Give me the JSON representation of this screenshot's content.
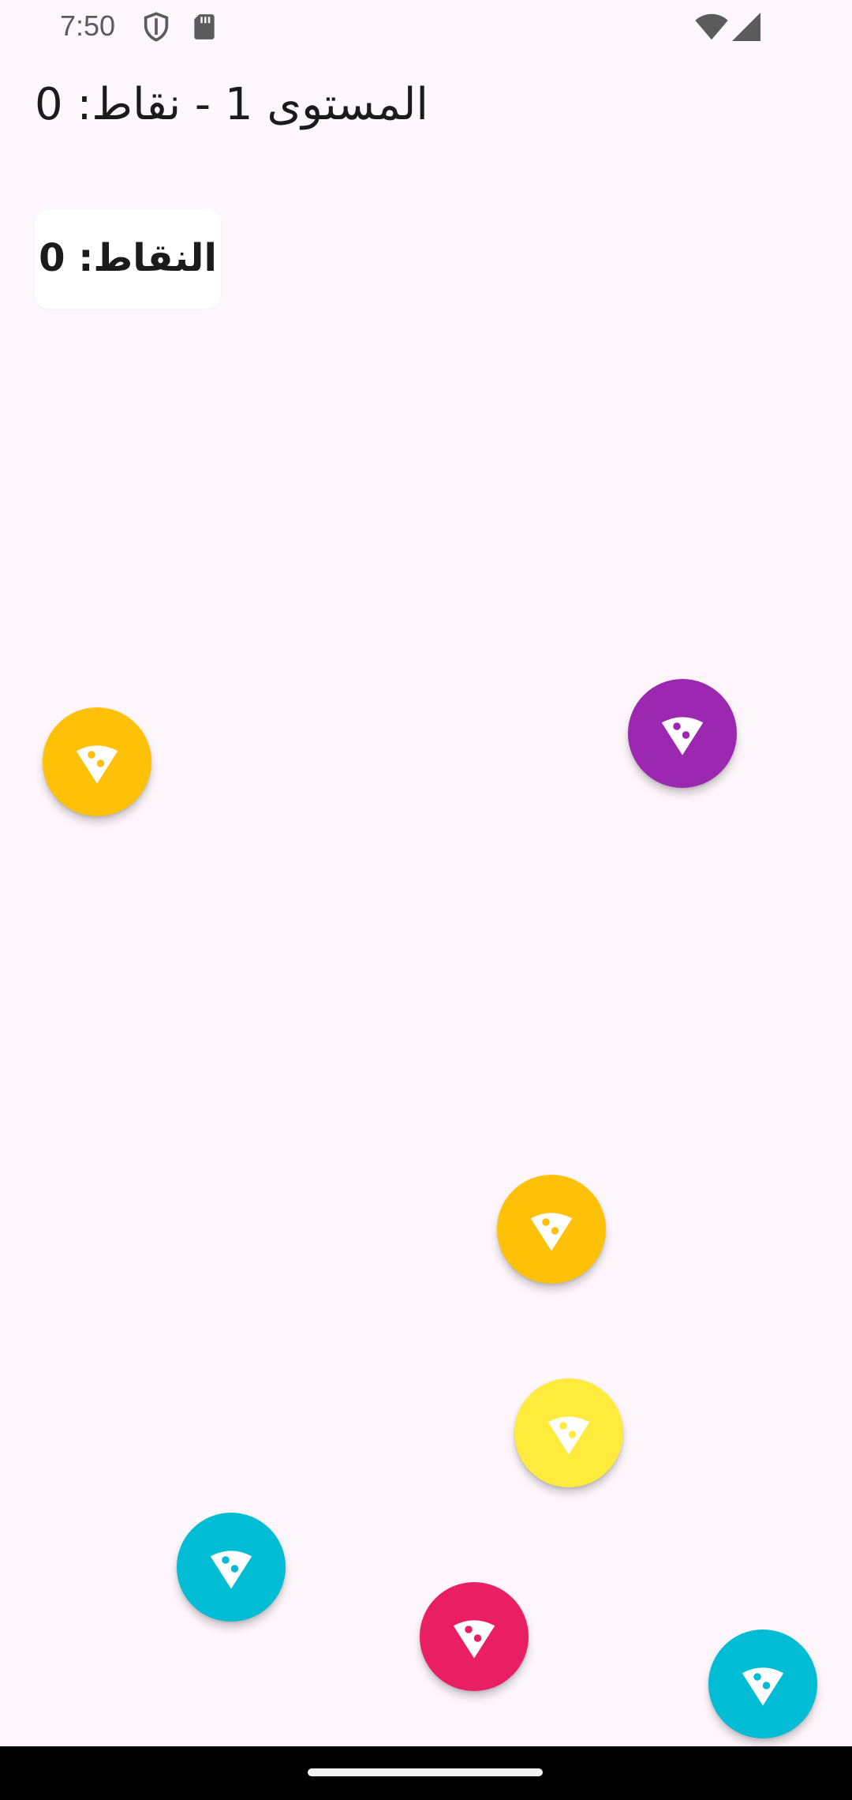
{
  "status_bar": {
    "time": "7:50",
    "icons": [
      "shield-icon",
      "sd-card-icon",
      "wifi-icon",
      "signal-icon"
    ]
  },
  "header": {
    "title": "المستوى 1 - نقاط: 0"
  },
  "score_card": {
    "label": "النقاط: 0"
  },
  "balls": [
    {
      "color": "#FFC107",
      "icon": "pizza-slice-icon"
    },
    {
      "color": "#9C27B0",
      "icon": "pizza-slice-icon"
    },
    {
      "color": "#FFC107",
      "icon": "pizza-slice-icon"
    },
    {
      "color": "#FFEB3B",
      "icon": "pizza-slice-icon"
    },
    {
      "color": "#00BCD4",
      "icon": "pizza-slice-icon"
    },
    {
      "color": "#E91E63",
      "icon": "pizza-slice-icon"
    },
    {
      "color": "#00BCD4",
      "icon": "pizza-slice-icon"
    }
  ],
  "colors": {
    "background": "#FDF6FB",
    "text": "#1B1B1B",
    "nav_bar": "#000000"
  }
}
